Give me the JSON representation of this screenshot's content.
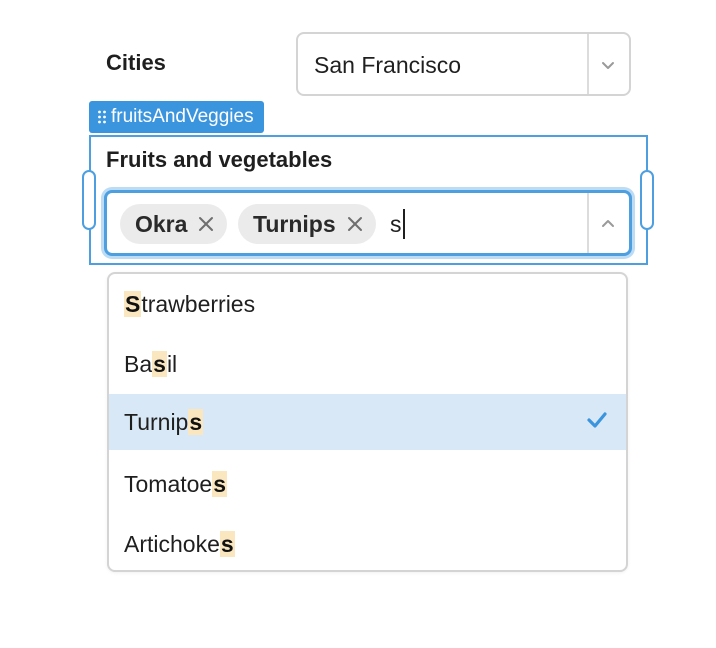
{
  "cities": {
    "label": "Cities",
    "selected_value": "San Francisco"
  },
  "component_tag": {
    "name": "fruitsAndVeggies"
  },
  "fruits": {
    "label": "Fruits and vegetables",
    "chips": [
      {
        "label": "Okra"
      },
      {
        "label": "Turnips"
      }
    ],
    "search_text": "s",
    "options": [
      {
        "before": "",
        "match": "S",
        "after": "trawberries",
        "selected": false
      },
      {
        "before": "Ba",
        "match": "s",
        "after": "il",
        "selected": false
      },
      {
        "before": "Turnip",
        "match": "s",
        "after": "",
        "selected": true
      },
      {
        "before": "Tomatoe",
        "match": "s",
        "after": "",
        "selected": false
      },
      {
        "before": "Artichoke",
        "match": "s",
        "after": "",
        "selected": false
      }
    ]
  },
  "colors": {
    "accent": "#3a95de",
    "focus_ring": "#bcdcf6",
    "selected_option_bg": "#d9e8f6",
    "match_highlight": "#fbe7bf",
    "chip_bg": "#ebebeb"
  },
  "icons": [
    "chevron-down-icon",
    "chevron-up-icon",
    "drag-handle-icon",
    "remove-chip-icon",
    "check-icon"
  ]
}
